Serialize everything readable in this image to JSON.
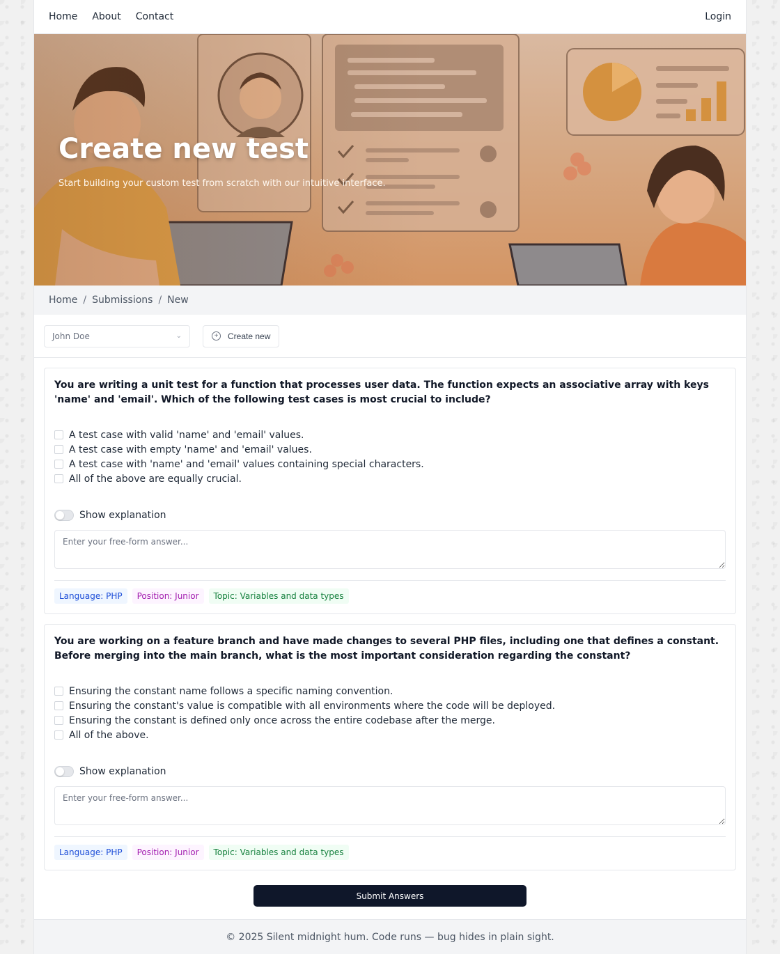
{
  "nav": {
    "links": [
      "Home",
      "About",
      "Contact"
    ],
    "login": "Login"
  },
  "hero": {
    "title": "Create new test",
    "subtitle": "Start building your custom test from scratch with our intuitive interface."
  },
  "breadcrumb": [
    "Home",
    "Submissions",
    "New"
  ],
  "toolbar": {
    "select_value": "John Doe",
    "create_label": "Create new"
  },
  "questions": [
    {
      "text": "You are writing a unit test for a function that processes user data. The function expects an associative array with keys 'name' and 'email'. Which of the following test cases is most crucial to include?",
      "options": [
        "A test case with valid 'name' and 'email' values.",
        "A test case with empty 'name' and 'email' values.",
        "A test case with 'name' and 'email' values containing special characters.",
        "All of the above are equally crucial."
      ],
      "toggle_label": "Show explanation",
      "answer_placeholder": "Enter your free-form answer...",
      "tags": {
        "language": "Language: PHP",
        "position": "Position: Junior",
        "topic": "Topic: Variables and data types"
      }
    },
    {
      "text": "You are working on a feature branch and have made changes to several PHP files, including one that defines a constant. Before merging into the main branch, what is the most important consideration regarding the constant?",
      "options": [
        "Ensuring the constant name follows a specific naming convention.",
        "Ensuring the constant's value is compatible with all environments where the code will be deployed.",
        "Ensuring the constant is defined only once across the entire codebase after the merge.",
        "All of the above."
      ],
      "toggle_label": "Show explanation",
      "answer_placeholder": "Enter your free-form answer...",
      "tags": {
        "language": "Language: PHP",
        "position": "Position: Junior",
        "topic": "Topic: Variables and data types"
      }
    }
  ],
  "submit_label": "Submit Answers",
  "footer": "© 2025 Silent midnight hum. Code runs — bug hides in plain sight."
}
